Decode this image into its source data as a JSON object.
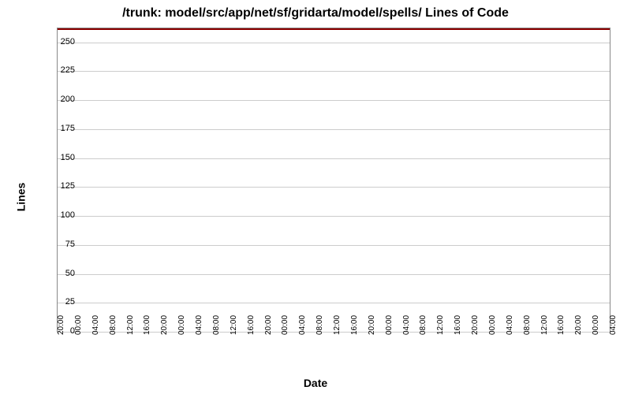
{
  "chart_data": {
    "type": "line",
    "title": "/trunk: model/src/app/net/sf/gridarta/model/spells/ Lines of Code",
    "xlabel": "Date",
    "ylabel": "Lines",
    "ylim": [
      0,
      262
    ],
    "y_ticks": [
      0,
      25,
      50,
      75,
      100,
      125,
      150,
      175,
      200,
      225,
      250
    ],
    "x_ticks": [
      "20:00",
      "00:00",
      "04:00",
      "08:00",
      "12:00",
      "16:00",
      "20:00",
      "00:00",
      "04:00",
      "08:00",
      "12:00",
      "16:00",
      "20:00",
      "00:00",
      "04:00",
      "08:00",
      "12:00",
      "16:00",
      "20:00",
      "00:00",
      "04:00",
      "08:00",
      "12:00",
      "16:00",
      "20:00",
      "00:00",
      "04:00",
      "08:00",
      "12:00",
      "16:00",
      "20:00",
      "00:00",
      "04:00"
    ],
    "series": [
      {
        "name": "Lines of Code",
        "color": "#8b0000",
        "values": [
          262,
          262,
          262,
          262,
          262,
          262,
          262,
          262,
          262,
          262,
          262,
          262,
          262,
          262,
          262,
          262,
          262,
          262,
          262,
          262,
          262,
          262,
          262,
          262,
          262,
          262,
          262,
          262,
          262,
          262,
          262,
          262,
          262
        ]
      }
    ]
  }
}
